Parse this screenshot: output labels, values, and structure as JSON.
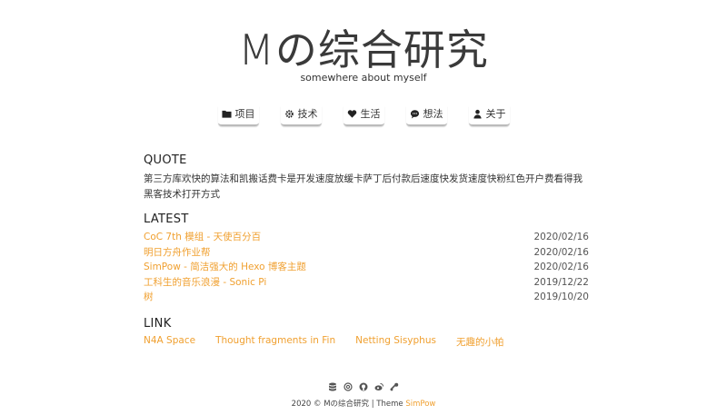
{
  "site": {
    "title": "Mの综合研究",
    "subtitle": "somewhere about myself"
  },
  "nav": [
    {
      "label": "项目",
      "icon": "folder-icon"
    },
    {
      "label": "技术",
      "icon": "gear-icon"
    },
    {
      "label": "生活",
      "icon": "heart-icon"
    },
    {
      "label": "想法",
      "icon": "comment-icon"
    },
    {
      "label": "关于",
      "icon": "user-icon"
    }
  ],
  "quote": {
    "heading": "QUOTE",
    "text": "第三方库欢快的算法和凯搬话费卡是开发速度放缓卡萨丁后付款后速度快发货速度快粉红色开户费看得我黑客技术打开方式"
  },
  "latest": {
    "heading": "LATEST",
    "posts": [
      {
        "title": "CoC 7th 模组 - 天使百分百",
        "date": "2020/02/16"
      },
      {
        "title": "明日方舟作业帮",
        "date": "2020/02/16"
      },
      {
        "title": "SimPow - 简洁强大的 Hexo 博客主题",
        "date": "2020/02/16"
      },
      {
        "title": "工科生的音乐浪漫 - Sonic Pi",
        "date": "2019/12/22"
      },
      {
        "title": "树",
        "date": "2019/10/20"
      }
    ]
  },
  "links": {
    "heading": "LINK",
    "items": [
      "N4A Space",
      "Thought fragments in Fin",
      "Netting Sisyphus",
      "无趣的小帕"
    ]
  },
  "footer": {
    "icons": [
      "database-icon",
      "at-icon",
      "github-icon",
      "weibo-icon",
      "steam-icon"
    ],
    "copyright": "2020 © Mの综合研究 | Theme ",
    "theme_name": "SimPow"
  },
  "colors": {
    "accent": "#f0a030",
    "text": "#333333"
  }
}
